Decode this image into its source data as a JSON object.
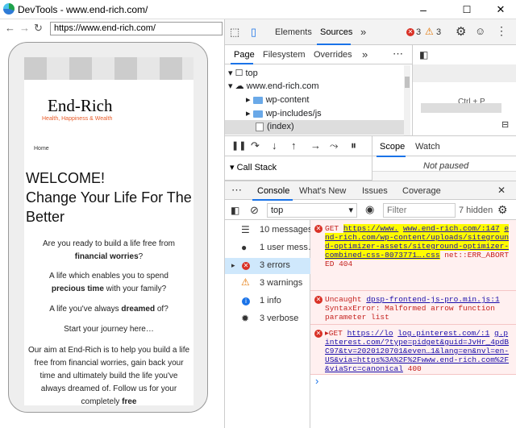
{
  "window": {
    "title": "DevTools - www.end-rich.com/",
    "controls": {
      "minimize": "–",
      "maximize": "☐",
      "close": "✕"
    }
  },
  "browser": {
    "back": "←",
    "forward": "→",
    "reload": "↻",
    "url": "https://www.end-rich.com/"
  },
  "site": {
    "logo": "End-Rich",
    "tagline": "Health, Happiness & Wealth",
    "home": "Home",
    "welcome_line1": "WELCOME!",
    "welcome_line2": "Change Your Life For The Better",
    "p1": "Are you ready to build a life free from",
    "p1_bold": "financial worries",
    "p1_end": "?",
    "p2": "A life which enables you to spend",
    "p2_bold": "precious time",
    "p2_end": "with your family?",
    "p3": "A life you've always",
    "p3_bold": "dreamed",
    "p3_end": "of?",
    "p4": "Start your journey here…",
    "p5": "Our aim at End-Rich is to help you build a life free from financial worries, gain back your time and ultimately build the life you've always dreamed of. Follow us for your completely",
    "p5_bold": "free"
  },
  "devtools": {
    "main_tabs": [
      "Elements",
      "Sources",
      "»"
    ],
    "error_count": "3",
    "warning_count": "3",
    "nav_tabs": [
      "Page",
      "Filesystem",
      "Overrides",
      "»",
      "⋯"
    ],
    "tree": {
      "top": "top",
      "domain": "www.end-rich.com",
      "folders": [
        "wp-content",
        "wp-includes/js"
      ],
      "index": "(index)"
    },
    "editor_hint": "Ctrl + P",
    "debugger_tabs": [
      "Scope",
      "Watch"
    ],
    "call_stack": "Call Stack",
    "not_paused": "Not paused",
    "drawer_tabs": [
      "Console",
      "What's New",
      "Issues",
      "Coverage"
    ],
    "console": {
      "context": "top",
      "filter_placeholder": "Filter",
      "hidden": "7 hidden",
      "sidebar": [
        {
          "label": "10 messages",
          "icon": "list-icon"
        },
        {
          "label": "1 user mess…",
          "icon": "user-icon"
        },
        {
          "label": "3 errors",
          "icon": "error-icon"
        },
        {
          "label": "3 warnings",
          "icon": "warning-icon"
        },
        {
          "label": "1 info",
          "icon": "info-icon"
        },
        {
          "label": "3 verbose",
          "icon": "bug-icon"
        }
      ],
      "log1": {
        "method": "GET",
        "url_a": "https://www.",
        "url_b": "www.end-rich.com/:147",
        "url_c": "end-rich.com/wp-content/uploads/siteground-optimizer-assets/siteground-optimizer-combined-css-8073771….css",
        "status": "net::ERR_ABORTED 404"
      },
      "log2": {
        "prefix": "Uncaught",
        "link": "dpsp-frontend-js-pro.min.js:1",
        "message": "SyntaxError: Malformed arrow function parameter list"
      },
      "log3": {
        "method": "▸GET",
        "url_a": "https://lo",
        "url_b": "log.pinterest.com/:1",
        "url_c": "g.pinterest.com/?type=pidget&guid=JvHr_4pdBC97&tv=2020120701&even…1&lang=en&nvl=en-US&via=https%3A%2F%2Fwww.end-rich.com%2F&viaSrc=canonical",
        "status": "400"
      },
      "prompt": "›"
    }
  }
}
